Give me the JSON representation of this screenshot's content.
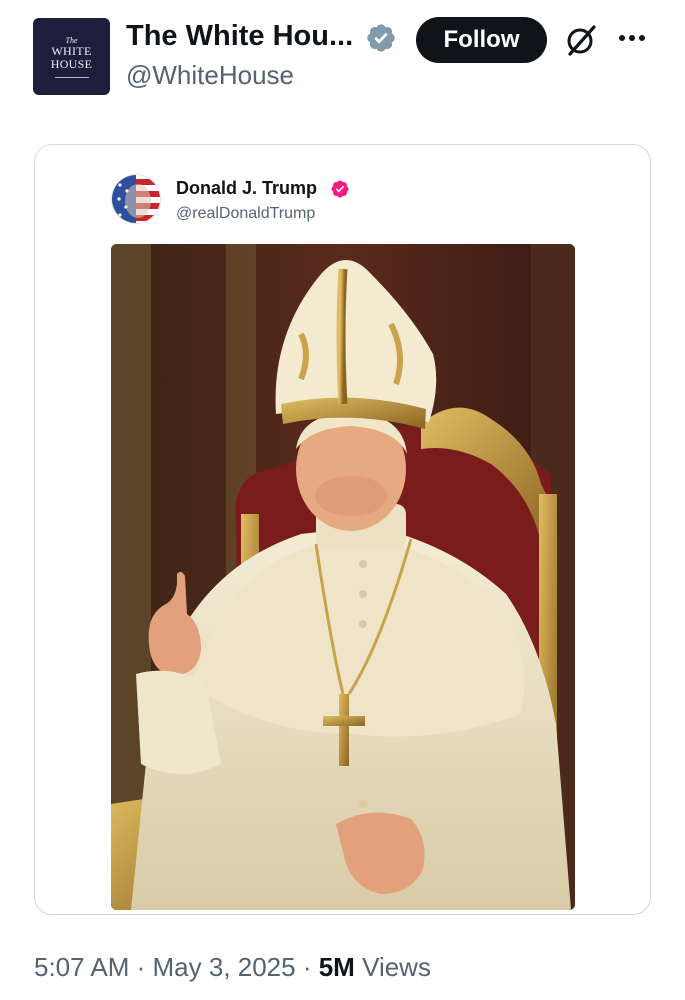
{
  "account": {
    "avatar_text": {
      "the": "The",
      "line1": "WHITE",
      "line2": "HOUSE"
    },
    "display_name": "The White Hou...",
    "handle": "@WhiteHouse",
    "verified_badge_color": "#829aab"
  },
  "actions": {
    "follow_label": "Follow"
  },
  "quoted_post": {
    "display_name": "Donald J. Trump",
    "handle": "@realDonaldTrump",
    "verified_badge_color": "#f91880"
  },
  "footer": {
    "time": "5:07 AM",
    "separator": " · ",
    "date": "May 3, 2025",
    "views_count": "5M",
    "views_label": " Views"
  },
  "colors": {
    "text_primary": "#0f1419",
    "text_secondary": "#536471",
    "border": "#cfd9de",
    "follow_button_bg": "#0f1419"
  }
}
